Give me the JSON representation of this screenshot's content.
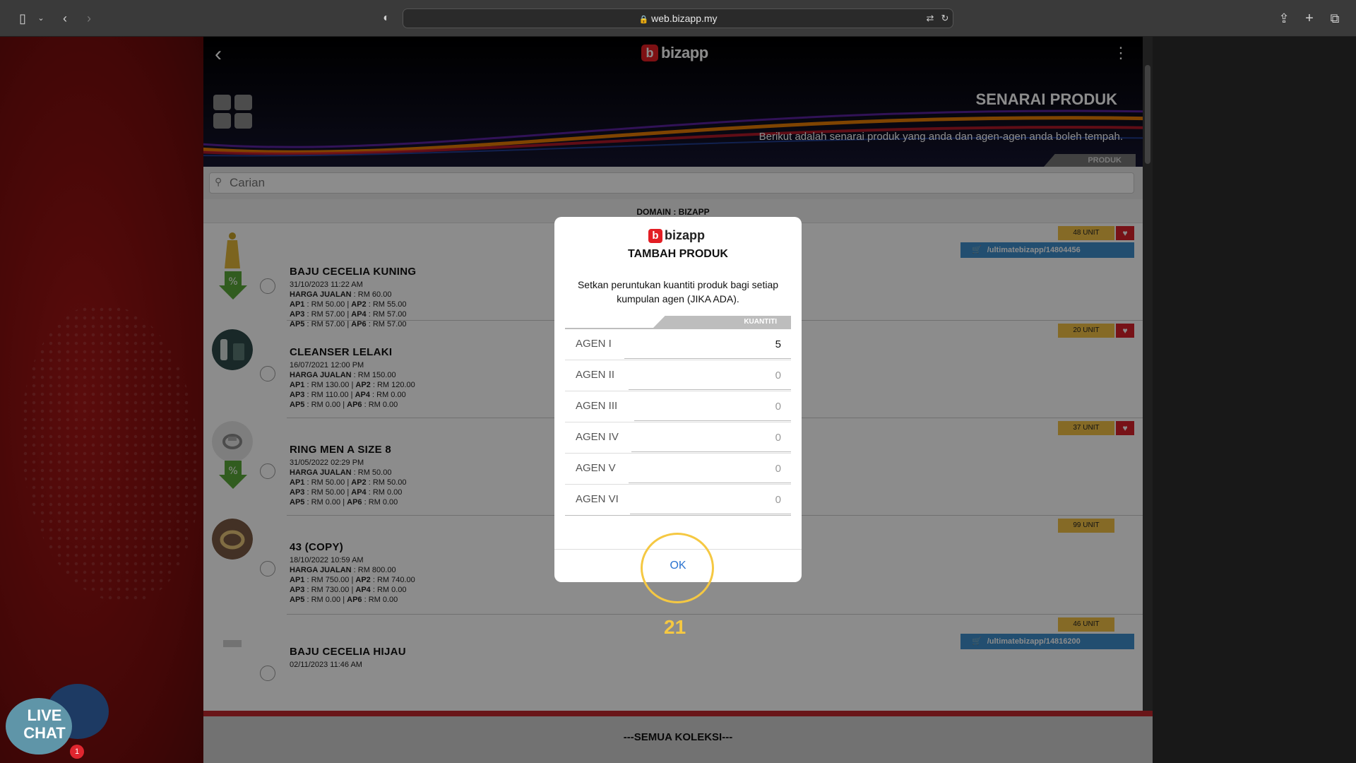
{
  "browser": {
    "url": "web.bizapp.my"
  },
  "header": {
    "logo_text": "bizapp",
    "title": "SENARAI PRODUK",
    "subtitle": "Berikut adalah senarai produk yang anda dan agen-agen anda boleh tempah.",
    "tab_label": "PRODUK"
  },
  "search": {
    "placeholder": "Carian"
  },
  "domain_label": "DOMAIN : BIZAPP",
  "products": [
    {
      "name": "BAJU CECELIA KUNING",
      "date": "31/10/2023 11:22 AM",
      "harga": "RM 60.00",
      "ap1": "RM 50.00",
      "ap2": "RM 55.00",
      "ap3": "RM 57.00",
      "ap4": "RM 57.00",
      "ap5": "RM 57.00",
      "ap6": "RM 57.00",
      "unit": "48 UNIT",
      "link": "/ultimatebizapp/14804456"
    },
    {
      "name": "CLEANSER LELAKI",
      "date": "16/07/2021 12:00 PM",
      "harga": "RM 150.00",
      "ap1": "RM 130.00",
      "ap2": "RM 120.00",
      "ap3": "RM 110.00",
      "ap4": "RM 0.00",
      "ap5": "RM 0.00",
      "ap6": "RM 0.00",
      "unit": "20 UNIT"
    },
    {
      "name": "RING MEN A SIZE 8",
      "date": "31/05/2022 02:29 PM",
      "harga": "RM 50.00",
      "ap1": "RM 50.00",
      "ap2": "RM 50.00",
      "ap3": "RM 50.00",
      "ap4": "RM 0.00",
      "ap5": "RM 0.00",
      "ap6": "RM 0.00",
      "unit": "37 UNIT"
    },
    {
      "name": "43 (COPY)",
      "date": "18/10/2022 10:59 AM",
      "harga": "RM 800.00",
      "ap1": "RM 750.00",
      "ap2": "RM 740.00",
      "ap3": "RM 730.00",
      "ap4": "RM 0.00",
      "ap5": "RM 0.00",
      "ap6": "RM 0.00",
      "unit": "99 UNIT"
    },
    {
      "name": "BAJU CECELIA HIJAU",
      "date": "02/11/2023 11:46 AM",
      "unit": "46 UNIT",
      "link": "/ultimatebizapp/14816200"
    }
  ],
  "labels": {
    "harga": "HARGA JUALAN",
    "ap1": "AP1",
    "ap2": "AP2",
    "ap3": "AP3",
    "ap4": "AP4",
    "ap5": "AP5",
    "ap6": "AP6"
  },
  "footer": {
    "label": "---SEMUA KOLEKSI---"
  },
  "modal": {
    "logo_text": "bizapp",
    "title": "TAMBAH PRODUK",
    "description": "Setkan peruntukan kuantiti produk bagi setiap kumpulan agen (JIKA ADA).",
    "column_header": "KUANTITI",
    "agents": [
      {
        "label": "AGEN I",
        "value": "5"
      },
      {
        "label": "AGEN II",
        "value": "0"
      },
      {
        "label": "AGEN III",
        "value": "0"
      },
      {
        "label": "AGEN IV",
        "value": "0"
      },
      {
        "label": "AGEN V",
        "value": "0"
      },
      {
        "label": "AGEN VI",
        "value": "0"
      }
    ],
    "ok_label": "OK"
  },
  "annotation": {
    "step": "21"
  },
  "livechat": {
    "line1": "LIVE",
    "line2": "CHAT",
    "badge": "1"
  },
  "colors": {
    "accent_red": "#e31e24",
    "unit_badge": "#f2c146",
    "link_blue": "#3f8fcd",
    "ok_blue": "#2a73d0",
    "highlight": "#f5c842"
  }
}
